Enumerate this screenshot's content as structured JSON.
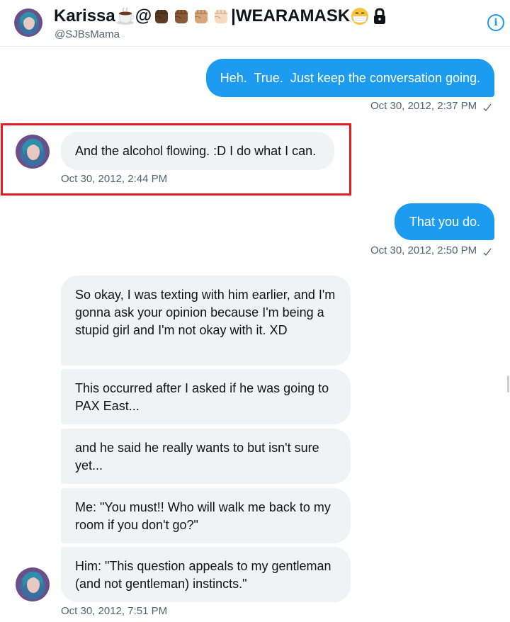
{
  "header": {
    "display_name": "Karissa",
    "emoji_separator_1": "@",
    "emoji_separator_2": "|",
    "name_suffix": "WEARAMASK",
    "handle": "@SJBsMama",
    "emoji_icons": [
      "coffee-cup-icon",
      "fist-dark-icon",
      "fist-medium-dark-icon",
      "fist-medium-icon",
      "fist-light-icon",
      "face-with-mask-icon",
      "lock-icon"
    ],
    "info_icon": "info-icon"
  },
  "messages": [
    {
      "direction": "out",
      "text": "Heh.  True.  Just keep the conversation going.",
      "time": "Oct 30, 2012, 2:37 PM",
      "status_icon": "checkmark-icon"
    },
    {
      "direction": "in",
      "text": "And the alcohol flowing. :D I do what I can.",
      "time": "Oct 30, 2012, 2:44 PM"
    },
    {
      "direction": "out",
      "text": "That you do.",
      "time": "Oct 30, 2012, 2:50 PM",
      "status_icon": "checkmark-icon"
    },
    {
      "direction": "in",
      "text": "So okay, I was texting with him earlier, and I'm gonna ask your opinion because I'm being a stupid girl and I'm not okay with it. XD"
    },
    {
      "direction": "in",
      "text": "This occurred after I asked if he was going to PAX East..."
    },
    {
      "direction": "in",
      "text": "and he said he really wants to but isn't sure yet..."
    },
    {
      "direction": "in",
      "text": "Me: \"You must!! Who will walk me back to my room if you don't go?\""
    },
    {
      "direction": "in",
      "text": "Him: \"This question appeals to my gentleman (and not gentleman) instincts.\"",
      "time": "Oct 30, 2012, 7:51 PM"
    }
  ],
  "colors": {
    "outgoing_bubble": "#1d9bf0",
    "incoming_bubble": "#eff3f4",
    "timestamp": "#536471",
    "highlight_border": "#e11d24"
  }
}
